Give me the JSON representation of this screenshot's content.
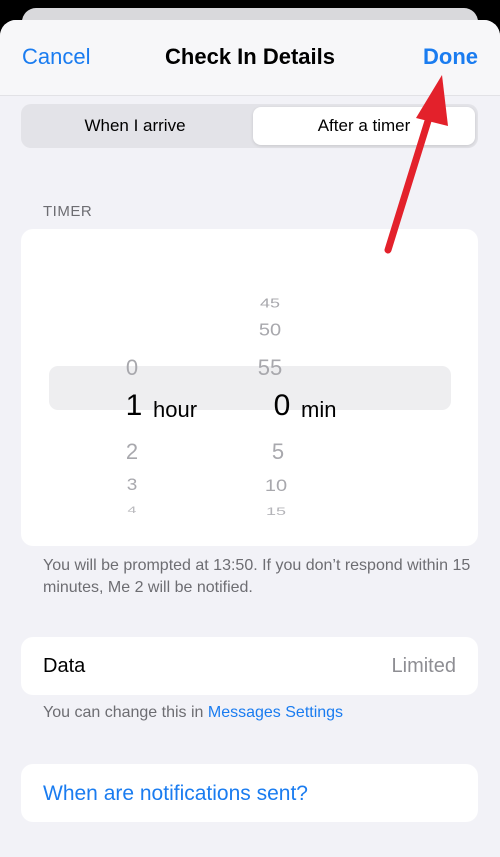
{
  "nav": {
    "cancel_label": "Cancel",
    "title": "Check In Details",
    "done_label": "Done"
  },
  "segmented": {
    "options": [
      "When I arrive",
      "After a timer"
    ],
    "selected_index": 1
  },
  "timer": {
    "section_header": "TIMER",
    "hours": {
      "above": [
        "0"
      ],
      "selected": "1",
      "below": [
        "2",
        "3",
        "4"
      ],
      "unit": "hour"
    },
    "minutes": {
      "above": [
        "45",
        "50",
        "55"
      ],
      "selected": "0",
      "below": [
        "5",
        "10",
        "15"
      ],
      "unit": "min"
    },
    "footer": "You will be prompted at 13:50. If you don’t respond within 15 minutes, Me 2 will be notified."
  },
  "data_row": {
    "label": "Data",
    "value": "Limited"
  },
  "data_footer": {
    "prefix": "You can change this in ",
    "link": "Messages Settings"
  },
  "notifications_link": "When are notifications sent?",
  "colors": {
    "accent": "#1a7cf0",
    "annotation_arrow": "#e3212b"
  }
}
